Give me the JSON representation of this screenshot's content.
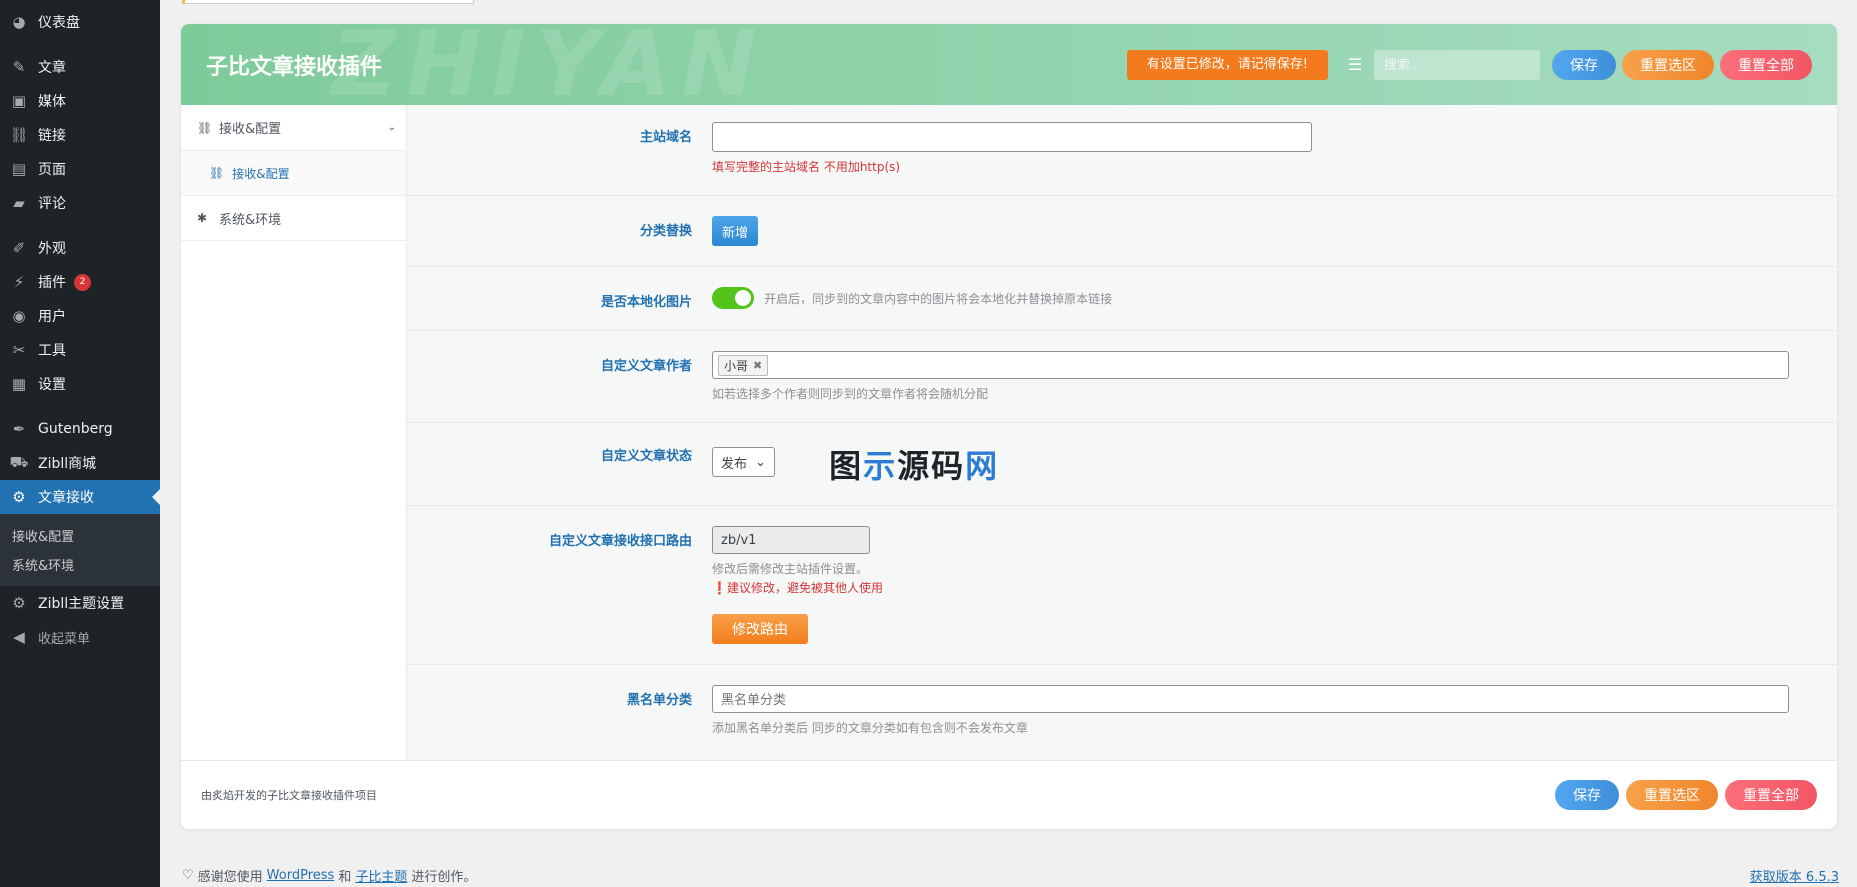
{
  "sidebar": {
    "items": [
      {
        "icon": "dashboard-icon",
        "glyph": "◕",
        "label": "仪表盘"
      },
      {
        "icon": "pin-icon",
        "glyph": "✎",
        "label": "文章"
      },
      {
        "icon": "media-icon",
        "glyph": "▣",
        "label": "媒体"
      },
      {
        "icon": "link-icon",
        "glyph": "⛓",
        "label": "链接"
      },
      {
        "icon": "pages-icon",
        "glyph": "▤",
        "label": "页面"
      },
      {
        "icon": "comments-icon",
        "glyph": "▰",
        "label": "评论"
      },
      {
        "icon": "appearance-icon",
        "glyph": "✐",
        "label": "外观"
      },
      {
        "icon": "plugins-icon",
        "glyph": "⚡",
        "label": "插件",
        "badge": "2"
      },
      {
        "icon": "users-icon",
        "glyph": "◉",
        "label": "用户"
      },
      {
        "icon": "tools-icon",
        "glyph": "✂",
        "label": "工具"
      },
      {
        "icon": "settings-icon",
        "glyph": "▦",
        "label": "设置"
      },
      {
        "icon": "gutenberg-icon",
        "glyph": "✒",
        "label": "Gutenberg"
      },
      {
        "icon": "cart-icon",
        "glyph": "⛟",
        "label": "Zibll商城"
      },
      {
        "icon": "gear-icon",
        "glyph": "⚙",
        "label": "文章接收"
      },
      {
        "icon": "gear-icon",
        "glyph": "⚙",
        "label": "Zibll主题设置"
      },
      {
        "icon": "collapse-icon",
        "glyph": "◀",
        "label": "收起菜单"
      }
    ],
    "submenu": [
      "接收&配置",
      "系统&环境"
    ]
  },
  "header": {
    "title": "子比文章接收插件",
    "watermark": "ZHIYAN",
    "notice": "有设置已修改，请记得保存!",
    "search_placeholder": "搜索...",
    "save": "保存",
    "reset_section": "重置选区",
    "reset_all": "重置全部"
  },
  "nav": {
    "section": "接收&配置",
    "sub": "接收&配置",
    "system": "系统&环境"
  },
  "fields": {
    "domain": {
      "label": "主站域名",
      "value": "",
      "help": "填写完整的主站域名 不用加http(s)"
    },
    "category": {
      "label": "分类替换",
      "button": "新增"
    },
    "localize": {
      "label": "是否本地化图片",
      "desc": "开启后，同步到的文章内容中的图片将会本地化并替换掉原本链接",
      "enabled": true
    },
    "author": {
      "label": "自定义文章作者",
      "tag": "小哥",
      "desc": "如若选择多个作者则同步到的文章作者将会随机分配"
    },
    "status": {
      "label": "自定义文章状态",
      "value": "发布"
    },
    "watermark_logo": {
      "part1": "图",
      "part2": "示",
      "part3": "源码",
      "part4": "网"
    },
    "route": {
      "label": "自定义文章接收接口路由",
      "value": "zb/v1",
      "desc": "修改后需修改主站插件设置。",
      "warning": "建议修改，避免被其他人使用",
      "button": "修改路由"
    },
    "blacklist": {
      "label": "黑名单分类",
      "placeholder": "黑名单分类",
      "desc": "添加黑名单分类后 同步的文章分类如有包含则不会发布文章"
    }
  },
  "footer": {
    "note": "由炙焰开发的子比文章接收插件项目",
    "save": "保存",
    "reset_section": "重置选区",
    "reset_all": "重置全部"
  },
  "wp_footer": {
    "prefix": "感谢您使用",
    "wordpress": "WordPress",
    "and": "和",
    "theme": "子比主题",
    "suffix": "进行创作。",
    "version": "获取版本 6.5.3"
  }
}
